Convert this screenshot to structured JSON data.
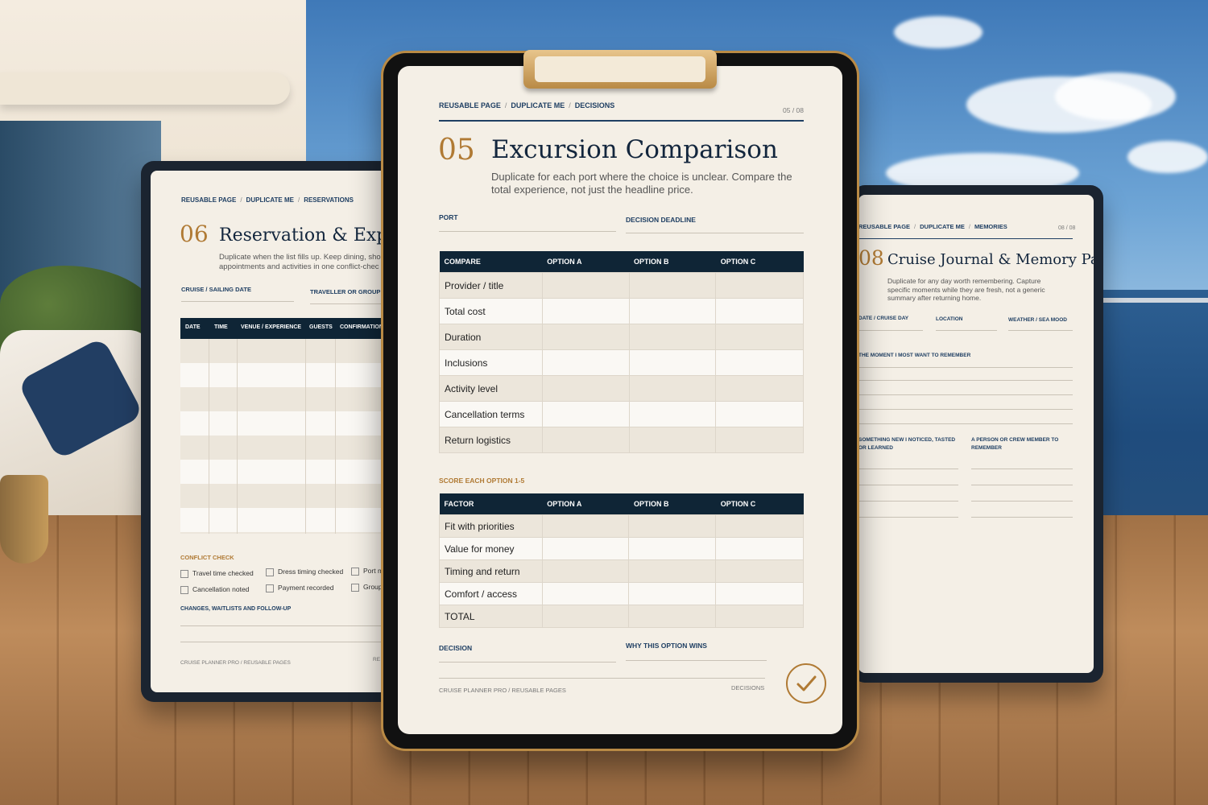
{
  "left": {
    "crumbs": [
      "REUSABLE PAGE",
      "DUPLICATE ME",
      "RESERVATIONS"
    ],
    "number": "06",
    "title": "Reservation & Experi",
    "subtitle": "Duplicate when the list fills up. Keep dining, sho appointments and activities in one conflict-chec",
    "field1": "CRUISE / SAILING DATE",
    "field2": "TRAVELLER OR GROUP",
    "columns": [
      "DATE",
      "TIME",
      "VENUE / EXPERIENCE",
      "GUESTS",
      "CONFIRMATION"
    ],
    "conflict_heading": "CONFLICT CHECK",
    "checks": [
      "Travel time checked",
      "Dress timing checked",
      "Port m",
      "Cancellation noted",
      "Payment recorded",
      "Group"
    ],
    "changes_heading": "CHANGES, WAITLISTS AND FOLLOW-UP",
    "footer": "CRUISE PLANNER PRO / REUSABLE PAGES",
    "footer_right": "RE"
  },
  "center": {
    "crumbs": [
      "REUSABLE PAGE",
      "DUPLICATE ME",
      "DECISIONS"
    ],
    "page": "05 / 08",
    "number": "05",
    "title": "Excursion Comparison",
    "subtitle": "Duplicate for each port where the choice is unclear. Compare the total experience, not just the headline price.",
    "port_label": "PORT",
    "deadline_label": "DECISION DEADLINE",
    "compare": {
      "headers": [
        "COMPARE",
        "OPTION A",
        "OPTION B",
        "OPTION C"
      ],
      "rows": [
        "Provider / title",
        "Total cost",
        "Duration",
        "Inclusions",
        "Activity level",
        "Cancellation terms",
        "Return logistics"
      ]
    },
    "score_heading": "SCORE EACH OPTION 1-5",
    "score": {
      "headers": [
        "FACTOR",
        "OPTION A",
        "OPTION B",
        "OPTION C"
      ],
      "rows": [
        "Fit with priorities",
        "Value for money",
        "Timing and return",
        "Comfort / access",
        "TOTAL"
      ]
    },
    "decision_label": "DECISION",
    "why_label": "WHY THIS OPTION WINS",
    "footer": "CRUISE PLANNER PRO / REUSABLE PAGES",
    "footer_right": "DECISIONS",
    "stamp_icon": "checkmark-icon"
  },
  "right": {
    "crumbs": [
      "REUSABLE PAGE",
      "DUPLICATE ME",
      "MEMORIES"
    ],
    "page": "08 / 08",
    "number": "08",
    "title": "Cruise Journal & Memory Page",
    "subtitle": "Duplicate for any day worth remembering. Capture specific moments while they are fresh, not a generic summary after returning home.",
    "field1": "DATE / CRUISE DAY",
    "field2": "LOCATION",
    "field3": "WEATHER / SEA MOOD",
    "moment_label": "THE MOMENT I MOST WANT TO REMEMBER",
    "noticed_label": "SOMETHING NEW I NOTICED, TASTED OR LEARNED",
    "person_label": "A PERSON OR CREW MEMBER TO REMEMBER"
  },
  "colors": {
    "navy": "#0f2536",
    "gold": "#b07a34",
    "paper": "#f4efe6"
  }
}
